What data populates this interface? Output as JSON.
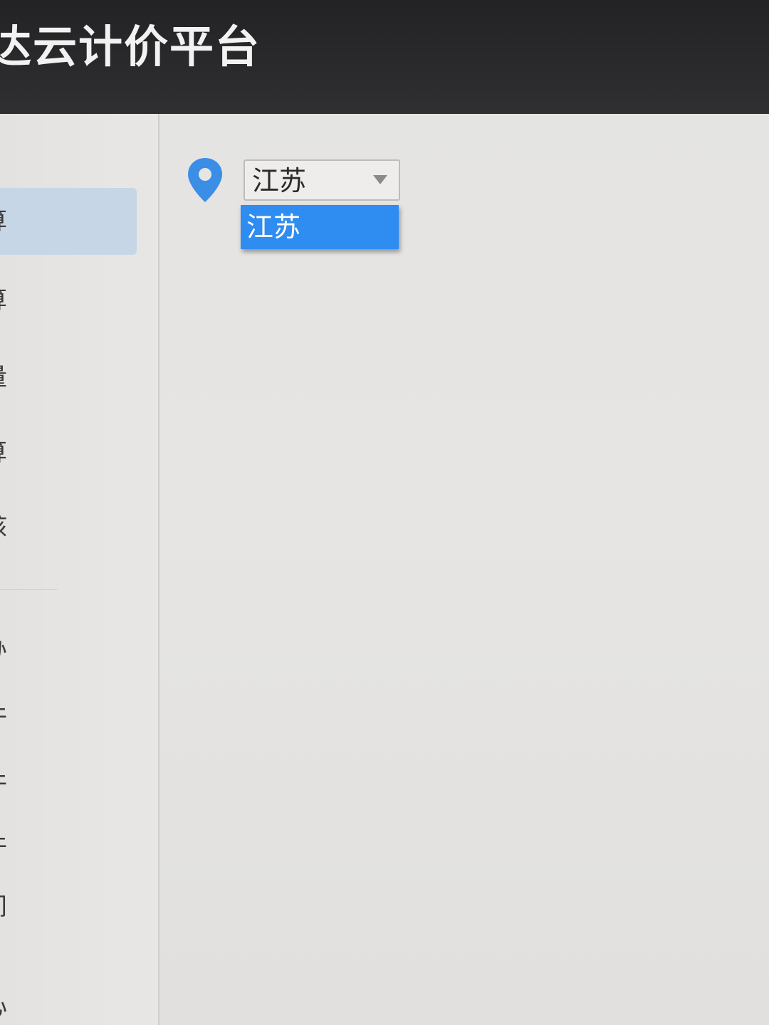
{
  "app": {
    "title": "达云计价平台"
  },
  "sidebar": {
    "items": [
      {
        "label": "算"
      },
      {
        "label": "算"
      },
      {
        "label": "量"
      },
      {
        "label": "算"
      },
      {
        "label": "核"
      },
      {
        "label": "办"
      },
      {
        "label": "件"
      },
      {
        "label": "件"
      },
      {
        "label": "件"
      },
      {
        "label": "间"
      },
      {
        "label": "心"
      }
    ]
  },
  "location": {
    "icon": "map-pin-icon",
    "selected": "江苏",
    "options": [
      "江苏"
    ]
  },
  "colors": {
    "header_bg": "#2a292b",
    "accent": "#2f8cf0",
    "pin": "#3a8ee6",
    "sidebar_active": "#c7d6e6"
  }
}
